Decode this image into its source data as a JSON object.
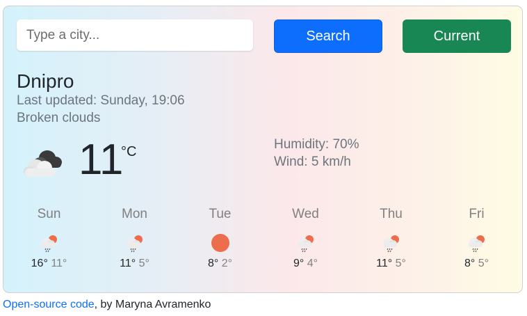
{
  "search": {
    "placeholder": "Type a city...",
    "value": ""
  },
  "buttons": {
    "search_label": "Search",
    "current_label": "Current"
  },
  "weather": {
    "city": "Dnipro",
    "last_updated": "Last updated: Sunday, 19:06",
    "description": "Broken clouds",
    "temperature": "11",
    "unit": "°C",
    "icon": "broken-clouds-icon",
    "humidity": "Humidity: 70%",
    "wind": "Wind: 5 km/h"
  },
  "forecast": [
    {
      "day": "Sun",
      "max": "16°",
      "min": "11°",
      "icon": "light-rain-icon"
    },
    {
      "day": "Mon",
      "max": "11°",
      "min": "5°",
      "icon": "light-rain-icon"
    },
    {
      "day": "Tue",
      "max": "8°",
      "min": "2°",
      "icon": "clear-sky-icon"
    },
    {
      "day": "Wed",
      "max": "9°",
      "min": "4°",
      "icon": "light-rain-icon"
    },
    {
      "day": "Thu",
      "max": "11°",
      "min": "5°",
      "icon": "light-rain-icon"
    },
    {
      "day": "Fri",
      "max": "8°",
      "min": "5°",
      "icon": "light-rain-icon"
    }
  ],
  "footer": {
    "link_text": "Open-source code",
    "suffix": ", by Maryna Avramenko"
  },
  "colors": {
    "primary": "#0d6efd",
    "success": "#198754",
    "sun": "#ec6e4c"
  }
}
